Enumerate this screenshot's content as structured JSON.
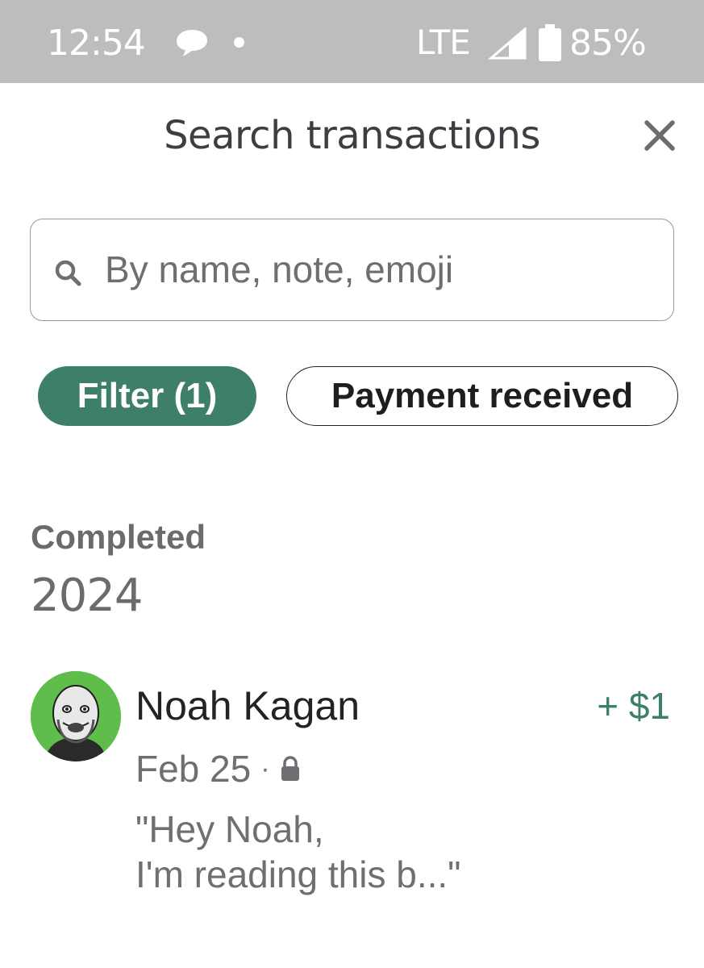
{
  "status_bar": {
    "time": "12:54",
    "network": "LTE",
    "battery": "85%",
    "icons": [
      "message-bubble-icon",
      "notification-dot",
      "signal-icon",
      "battery-icon"
    ]
  },
  "header": {
    "title": "Search transactions",
    "close_icon": "close-icon"
  },
  "search": {
    "placeholder": "By name, note, emoji",
    "value": "",
    "icon": "search-icon"
  },
  "filters": {
    "filter_label": "Filter (1)",
    "active_filter": "Payment received",
    "accent_color": "#3d7f67"
  },
  "section": {
    "status": "Completed",
    "year": "2024"
  },
  "transactions": [
    {
      "name": "Noah Kagan",
      "amount": "+ $1",
      "date": "Feb 25",
      "separator": "·",
      "privacy_icon": "lock-icon",
      "note_line1": "\"Hey Noah,",
      "note_line2": "I'm reading this b...\""
    }
  ]
}
